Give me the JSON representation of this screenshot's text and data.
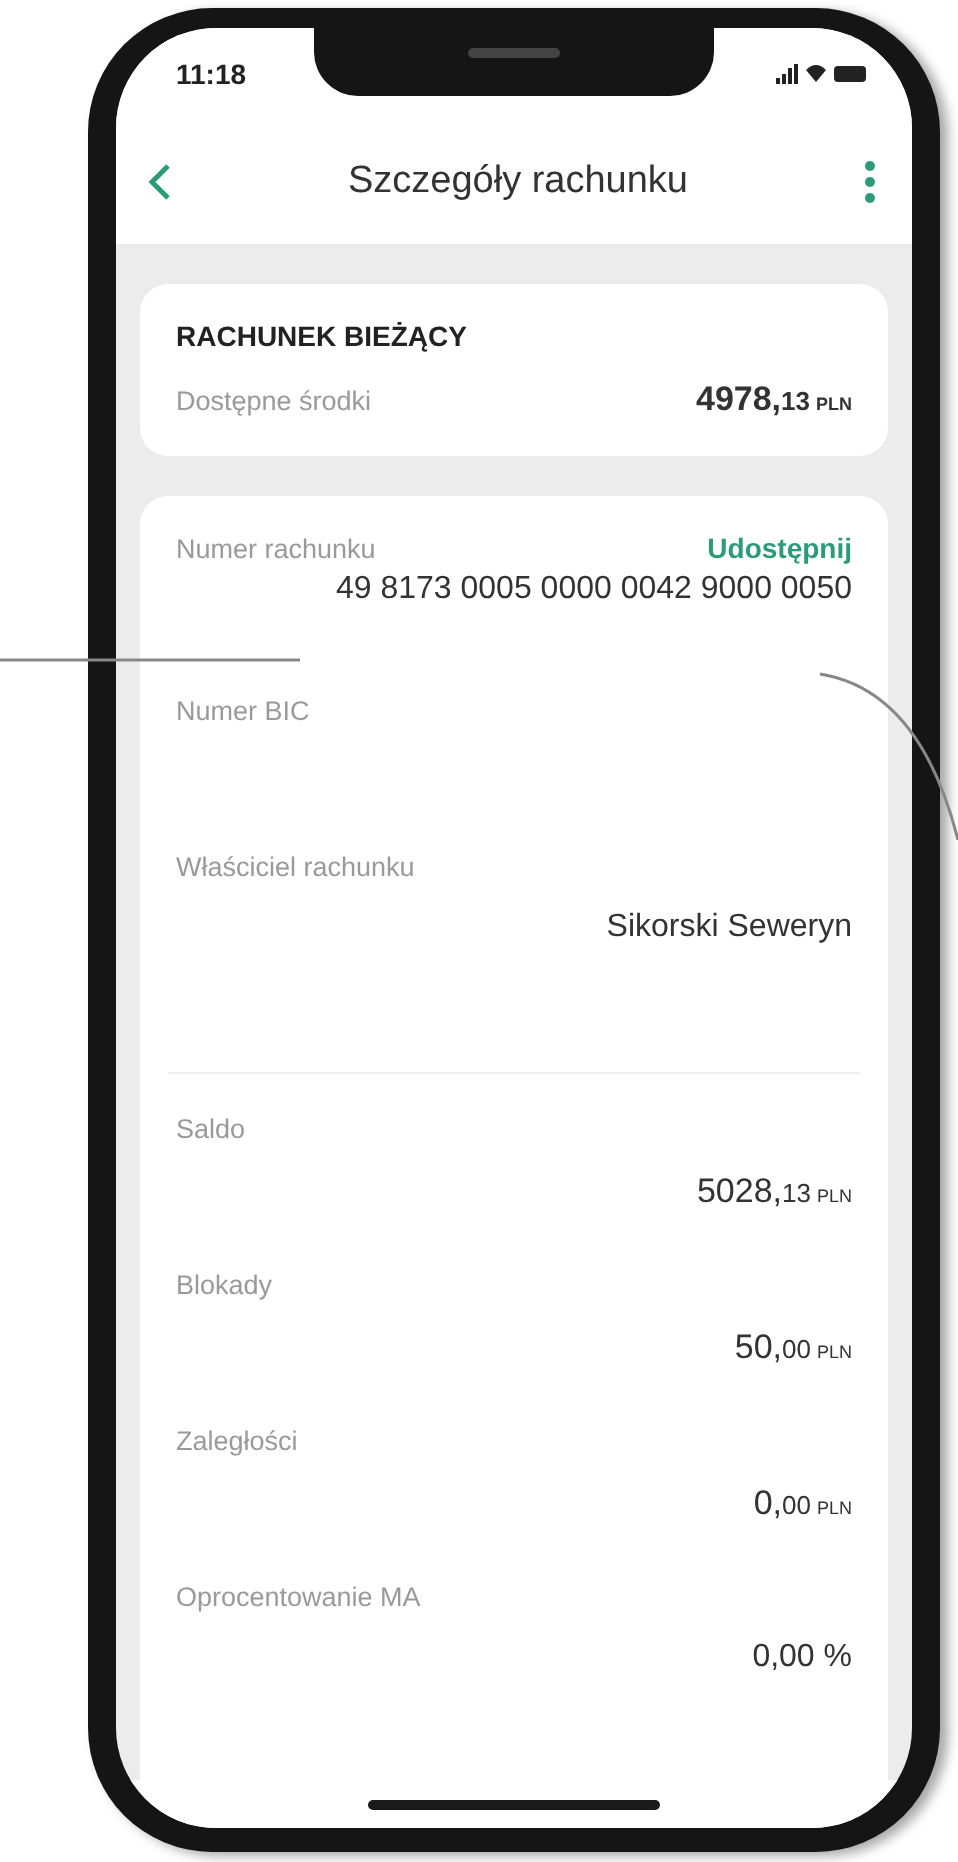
{
  "status_bar": {
    "time": "11:18"
  },
  "header": {
    "title": "Szczegóły rachunku"
  },
  "account_card": {
    "title": "RACHUNEK BIEŻĄCY",
    "label": "Dostępne środki",
    "amount": {
      "main": "4978,",
      "minor": "13",
      "currency": "PLN"
    }
  },
  "details": {
    "account_fields": [
      {
        "label": "Numer rachunku",
        "action": "Udostępnij",
        "kind": "text",
        "value": "49 8173 0005 0000 0042 9000 0050"
      },
      {
        "label": "Numer BIC",
        "kind": "empty"
      },
      {
        "label": "Właściciel rachunku",
        "kind": "text",
        "value": "Sikorski Seweryn"
      }
    ],
    "balance_fields": [
      {
        "label": "Saldo",
        "kind": "amount",
        "amount": {
          "main": "5028,",
          "minor": "13",
          "currency": "PLN"
        }
      },
      {
        "label": "Blokady",
        "kind": "amount",
        "amount": {
          "main": "50,",
          "minor": "00",
          "currency": "PLN"
        }
      },
      {
        "label": "Zaległości",
        "kind": "amount",
        "amount": {
          "main": "0,",
          "minor": "00",
          "currency": "PLN"
        }
      },
      {
        "label": "Oprocentowanie MA",
        "kind": "text",
        "value": "0,00 %"
      }
    ]
  }
}
